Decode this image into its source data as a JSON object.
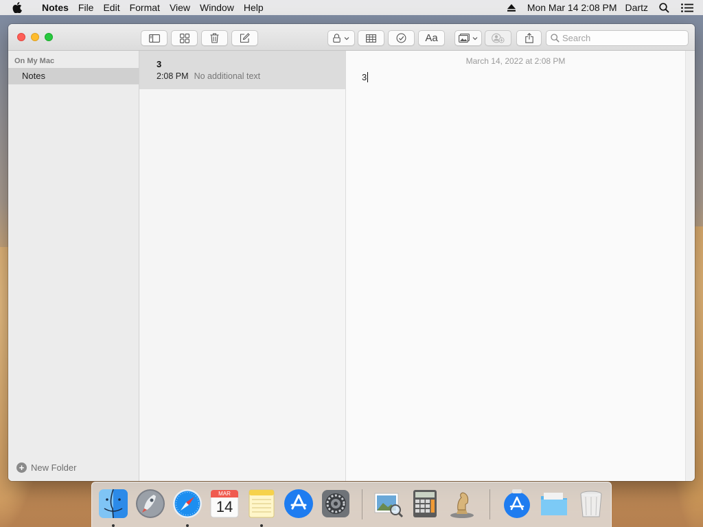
{
  "menubar": {
    "app_name": "Notes",
    "menus": [
      "File",
      "Edit",
      "Format",
      "View",
      "Window",
      "Help"
    ],
    "datetime": "Mon Mar 14  2:08 PM",
    "user": "Dartz"
  },
  "toolbar": {
    "search_placeholder": "Search"
  },
  "sidebar": {
    "section_header": "On My Mac",
    "items": [
      {
        "label": "Notes",
        "selected": true
      }
    ],
    "new_folder_label": "New Folder"
  },
  "notes_list": {
    "notes": [
      {
        "title": "3",
        "time": "2:08 PM",
        "preview": "No additional text",
        "selected": true
      }
    ]
  },
  "editor": {
    "date": "March 14, 2022 at 2:08 PM",
    "body": "3"
  },
  "dock": {
    "apps": [
      {
        "name": "Finder",
        "running": true
      },
      {
        "name": "Launchpad",
        "running": false
      },
      {
        "name": "Safari",
        "running": true
      },
      {
        "name": "Calendar",
        "running": false,
        "month": "MAR",
        "day": "14"
      },
      {
        "name": "Notes",
        "running": true
      },
      {
        "name": "App Store",
        "running": false
      },
      {
        "name": "System Preferences",
        "running": false
      },
      {
        "name": "Preview",
        "running": false
      },
      {
        "name": "Calculator",
        "running": false
      },
      {
        "name": "Chess",
        "running": false
      },
      {
        "name": "App Store Downloads",
        "running": false
      },
      {
        "name": "Folder",
        "running": false
      },
      {
        "name": "Trash",
        "running": false
      }
    ]
  },
  "colors": {
    "selection_gray": "#d0d0d0",
    "close": "#fe5f57",
    "minimize": "#febc2e",
    "zoom": "#28c840",
    "dock_blue": "#1e7cf0"
  }
}
